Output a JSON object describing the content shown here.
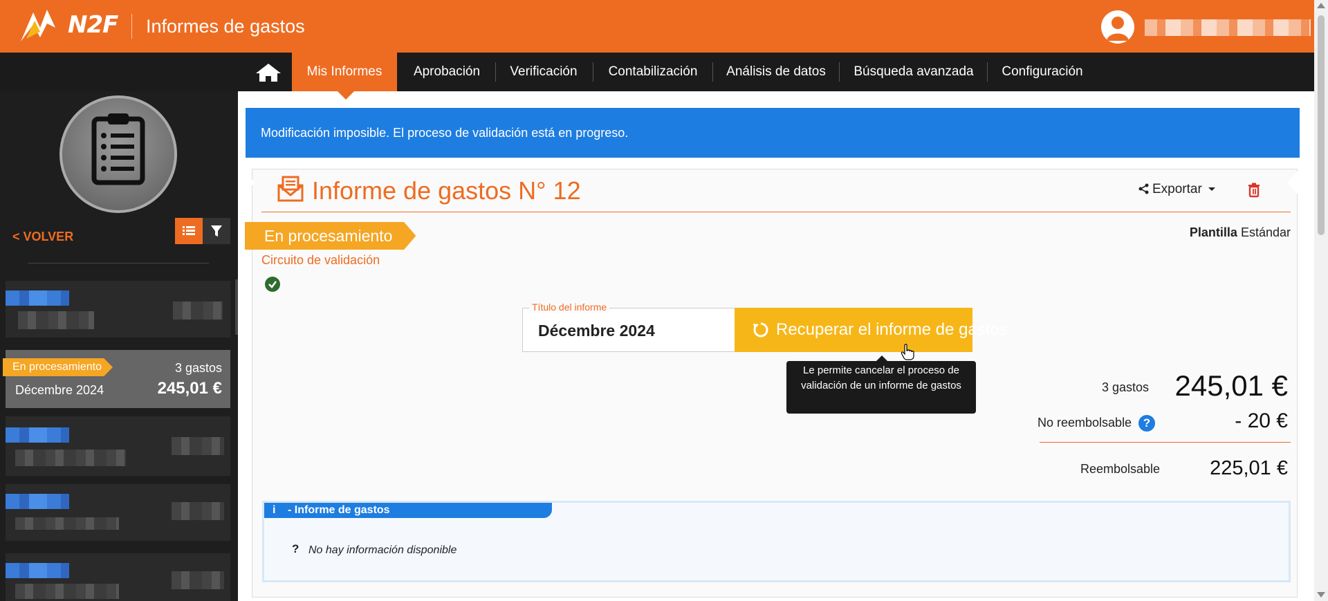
{
  "header": {
    "logo_text": "N2F",
    "app_title": "Informes de gastos"
  },
  "nav": {
    "tabs": [
      {
        "label": "Mis Informes",
        "active": true
      },
      {
        "label": "Aprobación"
      },
      {
        "label": "Verificación"
      },
      {
        "label": "Contabilización"
      },
      {
        "label": "Análisis de datos"
      },
      {
        "label": "Búsqueda avanzada"
      },
      {
        "label": "Configuración"
      }
    ]
  },
  "sidebar": {
    "back_label": "< VOLVER",
    "selected_card": {
      "status": "En procesamiento",
      "count": "3 gastos",
      "title": "Décembre 2024",
      "amount": "245,01 €"
    }
  },
  "alert": {
    "message": "Modificación imposible. El proceso de validación está en progreso."
  },
  "report": {
    "title": "Informe de gastos N°  12",
    "export_label": "Exportar",
    "status": "En procesamiento",
    "template_label": "Plantilla",
    "template_value": "Estándar",
    "circuit_label": "Circuito de validación",
    "field_legend": "Título del informe",
    "field_value": "Décembre 2024",
    "recover_label": "Recuperar el informe de gastos",
    "tooltip": "Le permite cancelar el proceso de validación de un informe de gastos"
  },
  "summary": {
    "count_label": "3 gastos",
    "total": "245,01 €",
    "non_refundable_label": "No reembolsable",
    "non_refundable_value": "- 20 €",
    "refundable_label": "Reembolsable",
    "refundable_value": "225,01 €"
  },
  "info": {
    "tab_label": "- Informe de gastos",
    "message": "No hay información disponible"
  },
  "colors": {
    "brand": "#ee6c22",
    "status": "#f5a623",
    "accent_blue": "#1e7de0",
    "button_yellow": "#f7b617"
  }
}
